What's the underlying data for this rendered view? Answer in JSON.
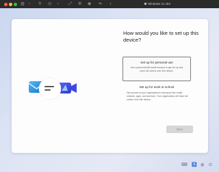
{
  "vm_window": {
    "title": "Windows 11 x64",
    "colors": {
      "close": "#ff5f57",
      "minimize": "#febc2e",
      "zoom": "#28c840"
    },
    "toolbar_icons": [
      "sidebar-icon",
      "back-icon",
      "forward-icon",
      "wrench-icon",
      "snapshot-icon",
      "fullscreen-icon",
      "settings-icon",
      "camera-icon",
      "sound-icon",
      "usb-icon"
    ]
  },
  "oobe": {
    "title": "How would you like to set up this device?",
    "options": [
      {
        "label": "Set up for personal use",
        "description": "Use a personal Microsoft account to get set up and have full control over this device."
      },
      {
        "label": "Set up for work or school",
        "description": "Get access to your organization's resources like email, network, apps, and services. Your organization will have full control over this device."
      }
    ],
    "next_label": "Next"
  },
  "illustration_icons": [
    "mail-icon",
    "chat-bubble-icon",
    "video-call-icon"
  ],
  "system_icons": [
    "keyboard-icon",
    "accessibility-icon",
    "network-icon",
    "power-icon"
  ]
}
